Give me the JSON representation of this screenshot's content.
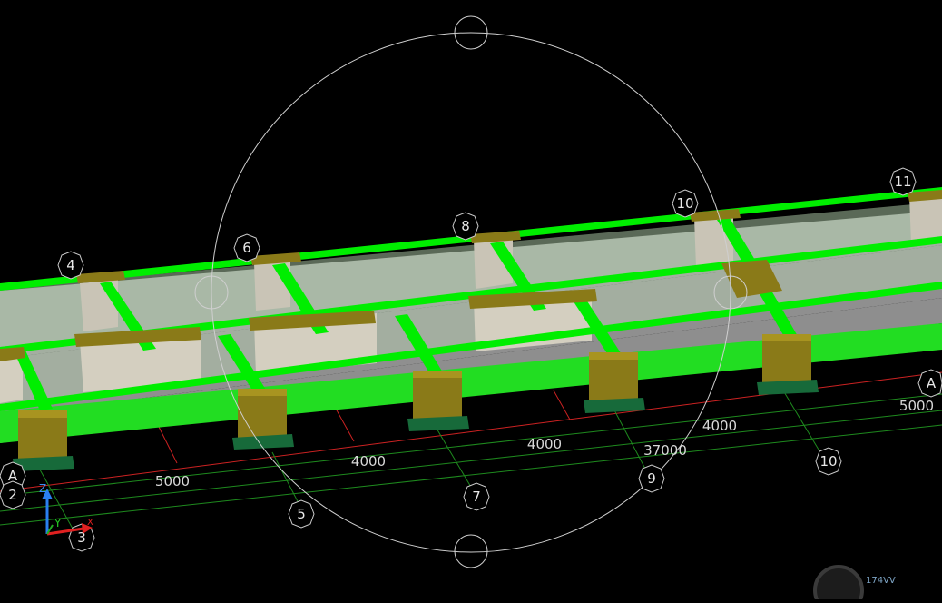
{
  "viewport": {
    "background": "#000000"
  },
  "colors": {
    "green": "#00ee00",
    "concrete": "#a9a9a9",
    "glass": "#c8e8c0",
    "gold": "#8a7a18",
    "gold_dark": "#5e5412",
    "dark_green": "#176a3a",
    "red_grid": "#cc2222",
    "green_grid": "#1e8a1e",
    "white": "#ffffff"
  },
  "grid_bubbles": {
    "top": [
      "4",
      "6",
      "8",
      "10",
      "11"
    ],
    "bottom": [
      "5",
      "7",
      "9",
      "10"
    ],
    "left": [
      "A",
      "2",
      "3"
    ],
    "right": [
      "A"
    ]
  },
  "dimensions": {
    "bays": [
      "5000",
      "4000",
      "4000",
      "4000"
    ],
    "overall": "37000",
    "right_end": "5000"
  },
  "axes": {
    "x": "X",
    "y": "Y",
    "z": "Z"
  },
  "navcube": {
    "label": "174VV"
  },
  "icons": {
    "orbit": "orbit-circle-icon",
    "axes": "ucs-axes-icon",
    "navcube": "navcube-icon"
  }
}
